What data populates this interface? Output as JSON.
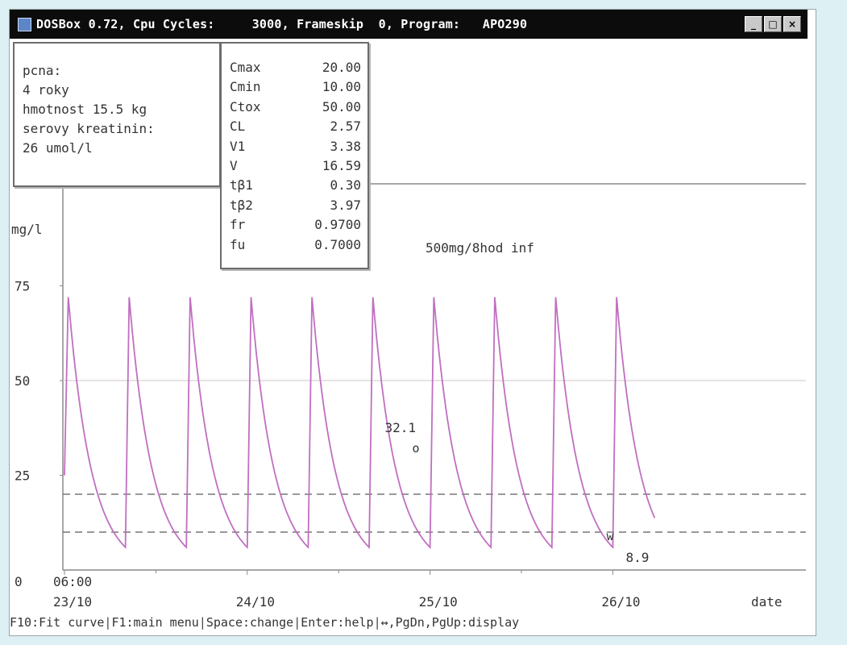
{
  "window": {
    "title": "DOSBox 0.72, Cpu Cycles:     3000, Frameskip  0, Program:   APO290",
    "buttons": [
      "_",
      "□",
      "×"
    ]
  },
  "patient_panel": {
    "lines": [
      "pcna:",
      "4 roky",
      "hmotnost 15.5 kg",
      "serovy kreatinin:",
      "26 umol/l"
    ]
  },
  "params_panel": {
    "rows": [
      {
        "label": "Cmax",
        "value": "20.00"
      },
      {
        "label": "Cmin",
        "value": "10.00"
      },
      {
        "label": "Ctox",
        "value": "50.00"
      },
      {
        "label": "CL",
        "value": "2.57"
      },
      {
        "label": "V1",
        "value": "3.38"
      },
      {
        "label": "V",
        "value": "16.59"
      },
      {
        "label": "tβ1",
        "value": "0.30"
      },
      {
        "label": "tβ2",
        "value": "3.97"
      },
      {
        "label": "fr",
        "value": "0.9700"
      },
      {
        "label": "fu",
        "value": "0.7000"
      }
    ]
  },
  "chart_data": {
    "type": "line",
    "title": "",
    "annotation_dose": "500mg/8hod inf",
    "ylabel": "mg/l",
    "ylim": [
      0,
      105
    ],
    "y_ticks": [
      {
        "value": 25,
        "label": "25"
      },
      {
        "value": 50,
        "label": "50"
      },
      {
        "value": 75,
        "label": "75"
      }
    ],
    "y_zero_label": "0",
    "x_axis_label": "date",
    "x_ticks": [
      {
        "hour": 0,
        "time": "06:00",
        "date": "23/10"
      },
      {
        "hour": 24,
        "date": "24/10"
      },
      {
        "hour": 48,
        "date": "25/10"
      },
      {
        "hour": 72,
        "date": "26/10"
      }
    ],
    "x_range_hours": [
      -0.5,
      77.5
    ],
    "gridlines": [
      50
    ],
    "reference_lines": [
      {
        "value": 20,
        "style": "dashed"
      },
      {
        "value": 10,
        "style": "dashed"
      }
    ],
    "series": [
      {
        "dose_interval_hours": 8,
        "first_dose_hour": 0,
        "infusion_hours": 0.5,
        "peak_value": 72,
        "trough_value": 6,
        "doses": 10
      }
    ],
    "points": [
      {
        "hour": 46.3,
        "value": 32.1,
        "label": "32.1",
        "marker": "o"
      },
      {
        "hour": 71.8,
        "value": 8.9,
        "label": "8.9",
        "marker": "w"
      }
    ]
  },
  "status_bar": {
    "items": [
      "F10:Fit curve",
      "F1:main menu",
      "Space:change",
      "Enter:help",
      "↔,PgDn,PgUp:display"
    ]
  },
  "colors": {
    "curve": "#c06fc0",
    "background": "#ddf0f3"
  }
}
